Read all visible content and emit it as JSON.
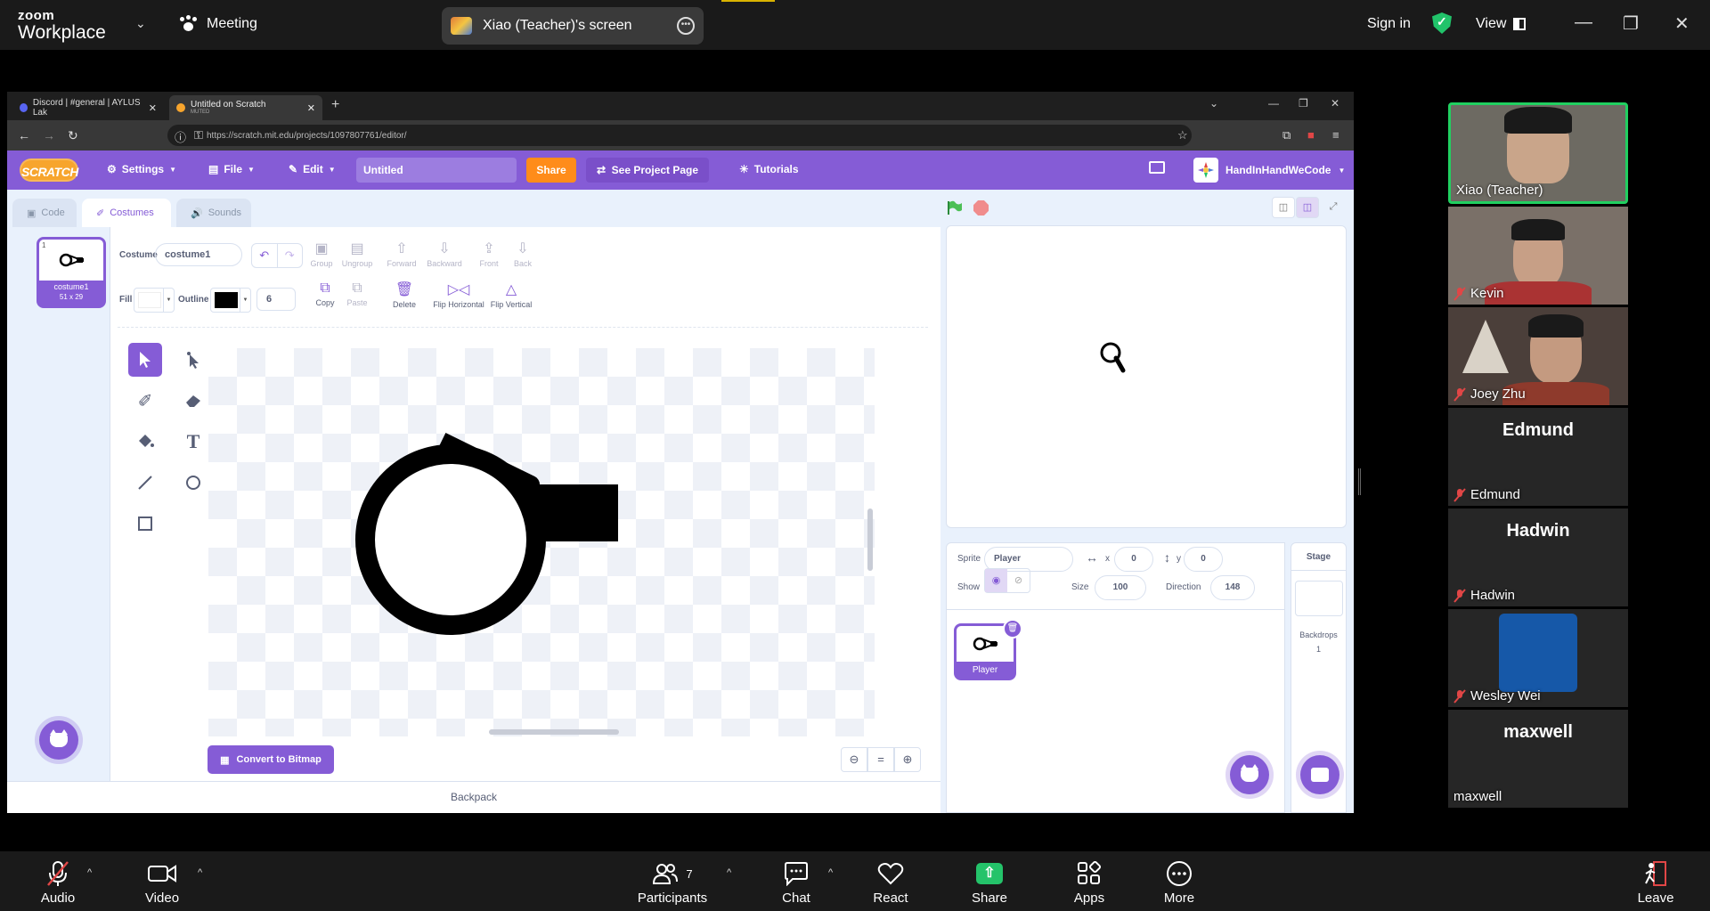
{
  "zoom": {
    "logo_top": "zoom",
    "logo_bottom": "Workplace",
    "meeting_label": "Meeting",
    "screen_share_label": "Xiao (Teacher)'s screen",
    "signin": "Sign in",
    "view": "View"
  },
  "browser": {
    "tabs": [
      {
        "title": "Discord | #general | AYLUS Lak"
      },
      {
        "title": "Untitled on Scratch",
        "subtitle": "MUTED"
      }
    ],
    "url": "https://scratch.mit.edu/projects/1097807761/editor/"
  },
  "scratch": {
    "logo": "SCRATCH",
    "menu": {
      "settings": "Settings",
      "file": "File",
      "edit": "Edit"
    },
    "project_title": "Untitled",
    "share": "Share",
    "see_project": "See Project Page",
    "tutorials": "Tutorials",
    "username": "HandInHandWeCode",
    "editor_tabs": {
      "code": "Code",
      "costumes": "Costumes",
      "sounds": "Sounds"
    },
    "costume_tile": {
      "number": "1",
      "name": "costume1",
      "size": "51 x 29"
    },
    "paint": {
      "costume_label": "Costume",
      "costume_name": "costume1",
      "fill_label": "Fill",
      "outline_label": "Outline",
      "outline_width": "6",
      "group": "Group",
      "ungroup": "Ungroup",
      "forward": "Forward",
      "backward": "Backward",
      "front": "Front",
      "back": "Back",
      "copy": "Copy",
      "paste": "Paste",
      "delete": "Delete",
      "flip_h": "Flip Horizontal",
      "flip_v": "Flip Vertical",
      "convert": "Convert to Bitmap",
      "fill_color": "#ffffff",
      "outline_color": "#000000"
    },
    "backpack": "Backpack",
    "sprite": {
      "sprite_label": "Sprite",
      "name": "Player",
      "x_label": "x",
      "x": "0",
      "y_label": "y",
      "y": "0",
      "show_label": "Show",
      "size_label": "Size",
      "size": "100",
      "direction_label": "Direction",
      "direction": "148",
      "tile_name": "Player"
    },
    "stage_pane": {
      "label": "Stage",
      "backdrops_label": "Backdrops",
      "backdrops_count": "1"
    },
    "accent": "#855cd6"
  },
  "participants": [
    {
      "name": "Xiao (Teacher)",
      "muted": false,
      "video": true,
      "active": true
    },
    {
      "name": "Kevin",
      "muted": true,
      "video": true
    },
    {
      "name": "Joey Zhu",
      "muted": true,
      "video": true
    },
    {
      "name": "Edmund",
      "muted": true,
      "video": false
    },
    {
      "name": "Hadwin",
      "muted": true,
      "video": false
    },
    {
      "name": "Wesley Wei",
      "muted": true,
      "video": false
    },
    {
      "name": "maxwell",
      "muted": false,
      "video": false
    }
  ],
  "toolbar": {
    "audio": "Audio",
    "video": "Video",
    "participants": "Participants",
    "participants_count": "7",
    "chat": "Chat",
    "react": "React",
    "share": "Share",
    "apps": "Apps",
    "more": "More",
    "leave": "Leave"
  }
}
